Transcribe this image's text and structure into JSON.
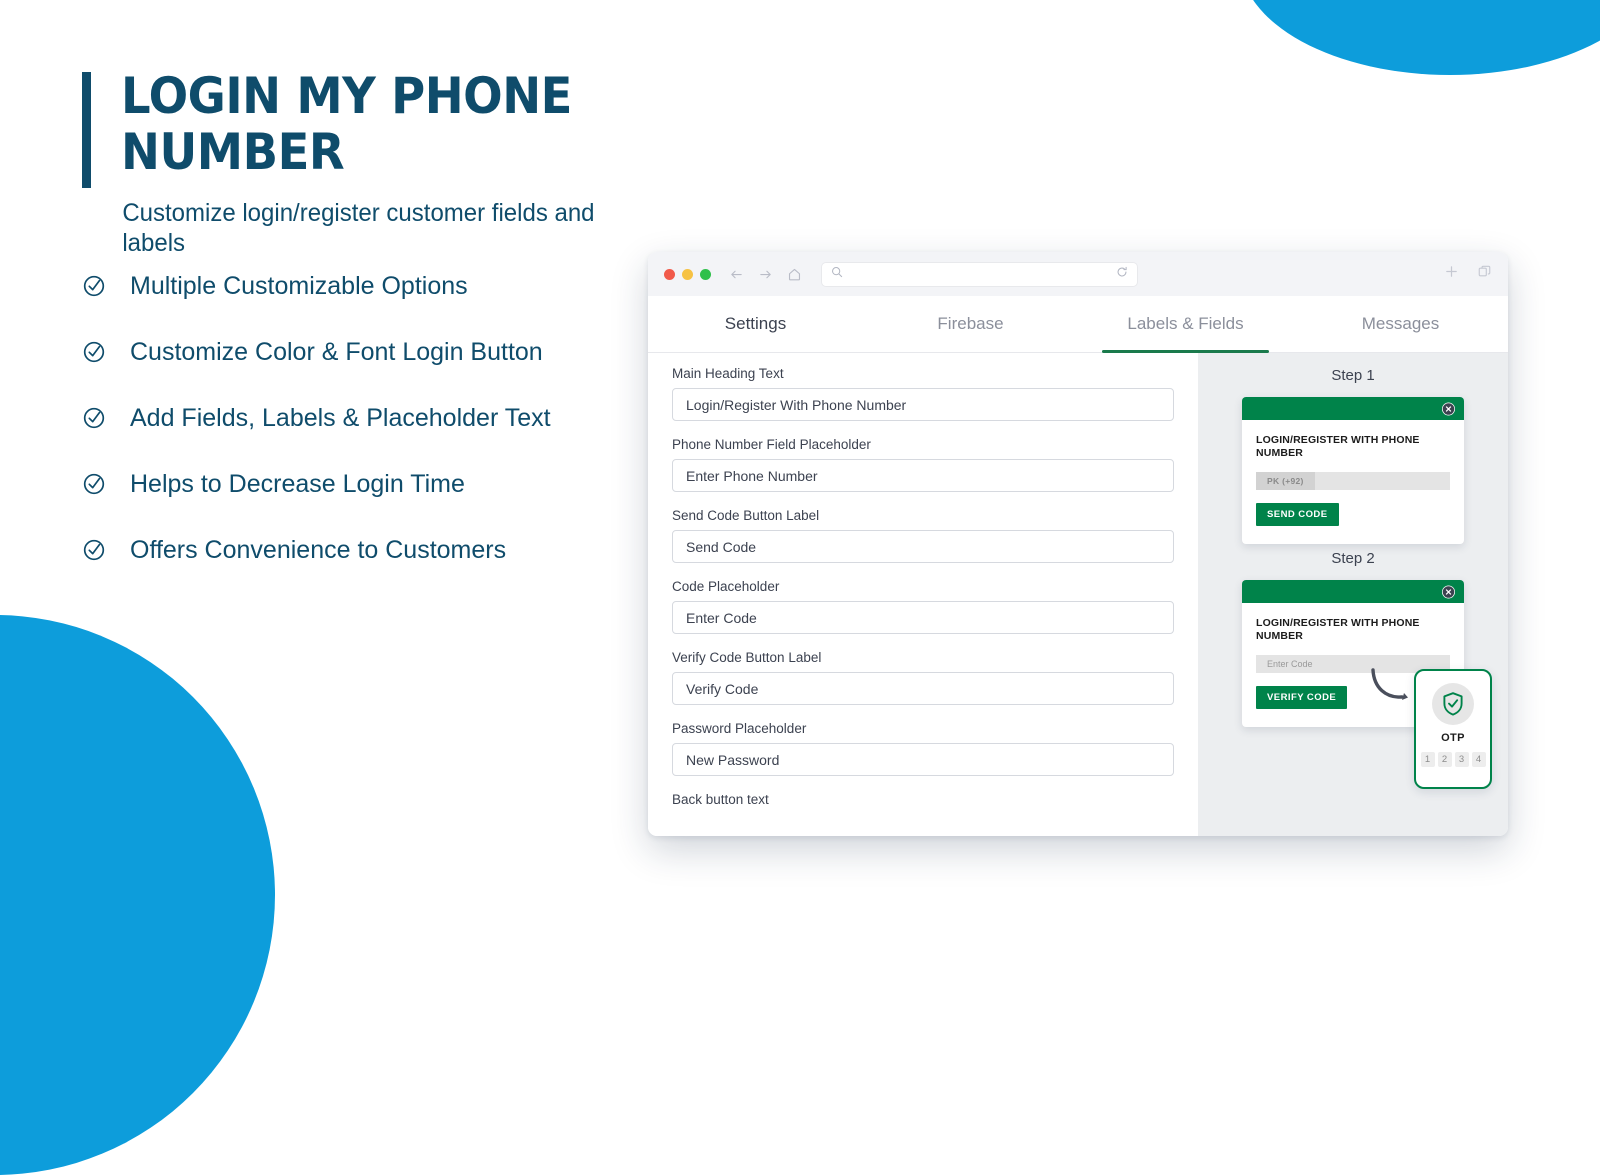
{
  "theme": {
    "navy": "#0f4c6b",
    "accent_blue": "#0d9ddb",
    "green": "#00834a",
    "tab_active_green": "#1a7a4c"
  },
  "hero": {
    "title": "LOGIN MY PHONE NUMBER",
    "subtitle": "Customize login/register customer fields and labels"
  },
  "features": [
    {
      "icon": "check-circle-icon",
      "label": "Multiple Customizable Options"
    },
    {
      "icon": "check-circle-icon",
      "label": "Customize Color & Font Login Button"
    },
    {
      "icon": "check-circle-icon",
      "label": "Add Fields, Labels & Placeholder Text"
    },
    {
      "icon": "check-circle-icon",
      "label": "Helps to Decrease Login Time"
    },
    {
      "icon": "check-circle-icon",
      "label": "Offers Convenience to Customers"
    }
  ],
  "browser": {
    "traffic_lights": [
      "close",
      "minimize",
      "maximize"
    ],
    "nav": {
      "back_icon": "arrow-left-icon",
      "forward_icon": "arrow-right-icon",
      "home_icon": "home-icon"
    },
    "address_bar": {
      "search_icon": "search-icon",
      "value": "",
      "placeholder": "",
      "reload_icon": "reload-icon"
    },
    "toolbar_right": {
      "new_tab_icon": "plus-icon",
      "tabs_icon": "copy-tabs-icon"
    }
  },
  "tabs": [
    {
      "label": "Settings",
      "active": false,
      "emphasis": true
    },
    {
      "label": "Firebase",
      "active": false,
      "emphasis": false
    },
    {
      "label": "Labels & Fields",
      "active": true,
      "emphasis": false
    },
    {
      "label": "Messages",
      "active": false,
      "emphasis": false
    }
  ],
  "form": {
    "fields": [
      {
        "label": "Main Heading Text",
        "value": "Login/Register With Phone Number"
      },
      {
        "label": "Phone Number Field Placeholder",
        "value": "Enter Phone Number"
      },
      {
        "label": "Send Code Button Label",
        "value": "Send Code"
      },
      {
        "label": "Code Placeholder",
        "value": "Enter Code"
      },
      {
        "label": "Verify Code Button Label",
        "value": "Verify Code"
      },
      {
        "label": "Password Placeholder",
        "value": "New Password"
      }
    ],
    "truncated_label": "Back button text"
  },
  "preview": {
    "step1": {
      "title": "Step 1",
      "close_icon": "close-circle-icon",
      "heading": "LOGIN/REGISTER WITH PHONE NUMBER",
      "country_code": "PK (+92)",
      "input_placeholder": "",
      "button_label": "SEND CODE"
    },
    "step2": {
      "title": "Step 2",
      "close_icon": "close-circle-icon",
      "heading": "LOGIN/REGISTER WITH PHONE NUMBER",
      "input_placeholder": "Enter Code",
      "button_label": "VERIFY CODE"
    },
    "otp": {
      "shield_icon": "shield-check-icon",
      "label": "OTP",
      "digits": [
        "1",
        "2",
        "3",
        "4"
      ],
      "pointer_icon": "curved-arrow-icon"
    }
  }
}
